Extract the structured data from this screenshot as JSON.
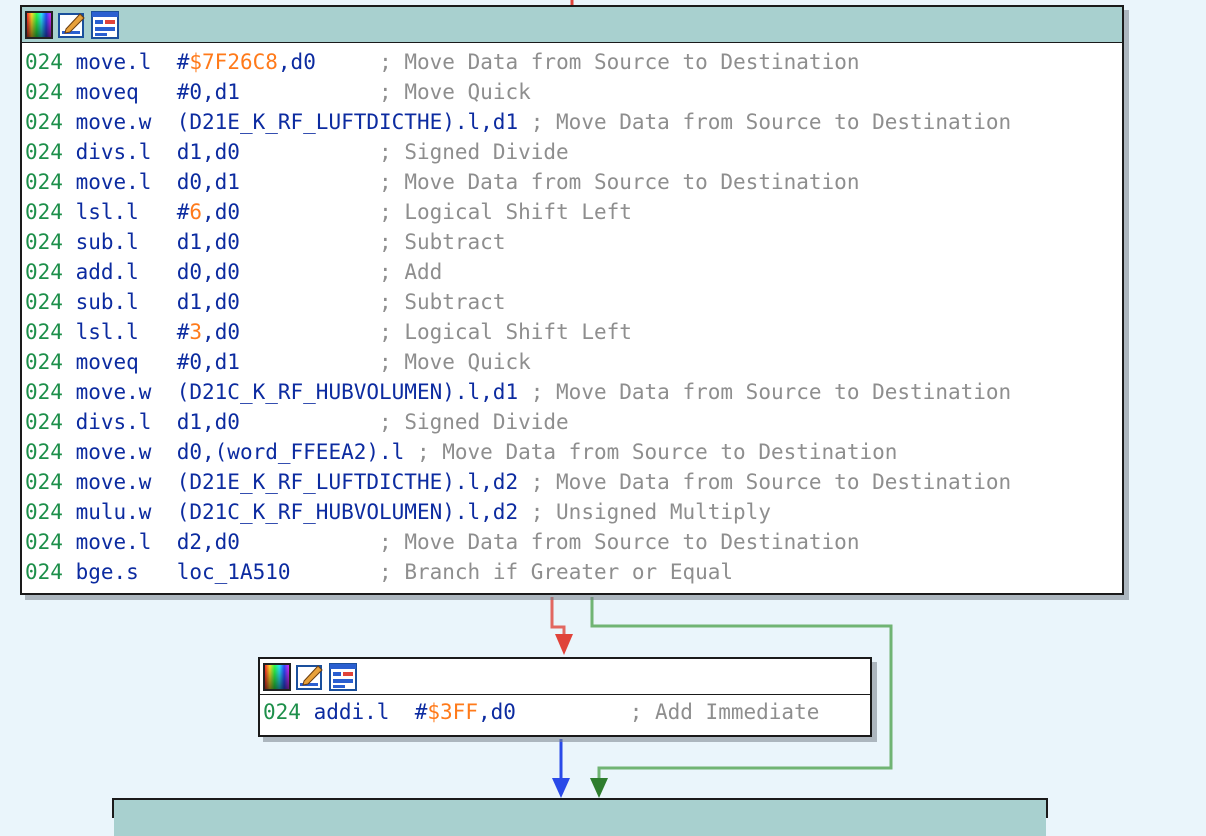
{
  "colors": {
    "background": "#eaf5fb",
    "header_active": "#a8d0cf",
    "segment": "#1d8f4a",
    "mnemonic": "#0c2ba0",
    "immediate": "#ff7a1a",
    "comment": "#8e8e8e",
    "edge_false": "#e0433a",
    "edge_true": "#5aa85a",
    "edge_normal": "#2a4ae8"
  },
  "main_block": {
    "header_icons": [
      "palette-icon",
      "rename-icon",
      "graph-icon"
    ],
    "lines": [
      [
        {
          "t": "seg",
          "v": "024"
        },
        {
          "t": "op",
          "v": " move.l  "
        },
        {
          "t": "op",
          "v": "#"
        },
        {
          "t": "imm",
          "v": "$7F26C8"
        },
        {
          "t": "op",
          "v": ",d0"
        },
        {
          "t": "pad",
          "v": "     "
        },
        {
          "t": "cmt",
          "v": "; Move Data from Source to Destination"
        }
      ],
      [
        {
          "t": "seg",
          "v": "024"
        },
        {
          "t": "op",
          "v": " moveq   "
        },
        {
          "t": "op",
          "v": "#0,d1"
        },
        {
          "t": "pad",
          "v": "           "
        },
        {
          "t": "cmt",
          "v": "; Move Quick"
        }
      ],
      [
        {
          "t": "seg",
          "v": "024"
        },
        {
          "t": "op",
          "v": " move.w  "
        },
        {
          "t": "op",
          "v": "(D21E_K_RF_LUFTDICTHE).l,d1 "
        },
        {
          "t": "cmt",
          "v": "; Move Data from Source to Destination"
        }
      ],
      [
        {
          "t": "seg",
          "v": "024"
        },
        {
          "t": "op",
          "v": " divs.l  "
        },
        {
          "t": "op",
          "v": "d1,d0"
        },
        {
          "t": "pad",
          "v": "           "
        },
        {
          "t": "cmt",
          "v": "; Signed Divide"
        }
      ],
      [
        {
          "t": "seg",
          "v": "024"
        },
        {
          "t": "op",
          "v": " move.l  "
        },
        {
          "t": "op",
          "v": "d0,d1"
        },
        {
          "t": "pad",
          "v": "           "
        },
        {
          "t": "cmt",
          "v": "; Move Data from Source to Destination"
        }
      ],
      [
        {
          "t": "seg",
          "v": "024"
        },
        {
          "t": "op",
          "v": " lsl.l   "
        },
        {
          "t": "op",
          "v": "#"
        },
        {
          "t": "imm",
          "v": "6"
        },
        {
          "t": "op",
          "v": ",d0"
        },
        {
          "t": "pad",
          "v": "           "
        },
        {
          "t": "cmt",
          "v": "; Logical Shift Left"
        }
      ],
      [
        {
          "t": "seg",
          "v": "024"
        },
        {
          "t": "op",
          "v": " sub.l   "
        },
        {
          "t": "op",
          "v": "d1,d0"
        },
        {
          "t": "pad",
          "v": "           "
        },
        {
          "t": "cmt",
          "v": "; Subtract"
        }
      ],
      [
        {
          "t": "seg",
          "v": "024"
        },
        {
          "t": "op",
          "v": " add.l   "
        },
        {
          "t": "op",
          "v": "d0,d0"
        },
        {
          "t": "pad",
          "v": "           "
        },
        {
          "t": "cmt",
          "v": "; Add"
        }
      ],
      [
        {
          "t": "seg",
          "v": "024"
        },
        {
          "t": "op",
          "v": " sub.l   "
        },
        {
          "t": "op",
          "v": "d1,d0"
        },
        {
          "t": "pad",
          "v": "           "
        },
        {
          "t": "cmt",
          "v": "; Subtract"
        }
      ],
      [
        {
          "t": "seg",
          "v": "024"
        },
        {
          "t": "op",
          "v": " lsl.l   "
        },
        {
          "t": "op",
          "v": "#"
        },
        {
          "t": "imm",
          "v": "3"
        },
        {
          "t": "op",
          "v": ",d0"
        },
        {
          "t": "pad",
          "v": "           "
        },
        {
          "t": "cmt",
          "v": "; Logical Shift Left"
        }
      ],
      [
        {
          "t": "seg",
          "v": "024"
        },
        {
          "t": "op",
          "v": " moveq   "
        },
        {
          "t": "op",
          "v": "#0,d1"
        },
        {
          "t": "pad",
          "v": "           "
        },
        {
          "t": "cmt",
          "v": "; Move Quick"
        }
      ],
      [
        {
          "t": "seg",
          "v": "024"
        },
        {
          "t": "op",
          "v": " move.w  "
        },
        {
          "t": "op",
          "v": "(D21C_K_RF_HUBVOLUMEN).l,d1 "
        },
        {
          "t": "cmt",
          "v": "; Move Data from Source to Destination"
        }
      ],
      [
        {
          "t": "seg",
          "v": "024"
        },
        {
          "t": "op",
          "v": " divs.l  "
        },
        {
          "t": "op",
          "v": "d1,d0"
        },
        {
          "t": "pad",
          "v": "           "
        },
        {
          "t": "cmt",
          "v": "; Signed Divide"
        }
      ],
      [
        {
          "t": "seg",
          "v": "024"
        },
        {
          "t": "op",
          "v": " move.w  "
        },
        {
          "t": "op",
          "v": "d0,(word_FFEEA2).l "
        },
        {
          "t": "cmt",
          "v": "; Move Data from Source to Destination"
        }
      ],
      [
        {
          "t": "seg",
          "v": "024"
        },
        {
          "t": "op",
          "v": " move.w  "
        },
        {
          "t": "op",
          "v": "(D21E_K_RF_LUFTDICTHE).l,d2 "
        },
        {
          "t": "cmt",
          "v": "; Move Data from Source to Destination"
        }
      ],
      [
        {
          "t": "seg",
          "v": "024"
        },
        {
          "t": "op",
          "v": " mulu.w  "
        },
        {
          "t": "op",
          "v": "(D21C_K_RF_HUBVOLUMEN).l,d2 "
        },
        {
          "t": "cmt",
          "v": "; Unsigned Multiply"
        }
      ],
      [
        {
          "t": "seg",
          "v": "024"
        },
        {
          "t": "op",
          "v": " move.l  "
        },
        {
          "t": "op",
          "v": "d2,d0"
        },
        {
          "t": "pad",
          "v": "           "
        },
        {
          "t": "cmt",
          "v": "; Move Data from Source to Destination"
        }
      ],
      [
        {
          "t": "seg",
          "v": "024"
        },
        {
          "t": "op",
          "v": " bge.s   "
        },
        {
          "t": "op",
          "v": "loc_1A510"
        },
        {
          "t": "pad",
          "v": "       "
        },
        {
          "t": "cmt",
          "v": "; Branch if Greater or Equal"
        }
      ]
    ]
  },
  "addi_block": {
    "header_icons": [
      "palette-icon",
      "rename-icon",
      "graph-icon"
    ],
    "lines": [
      [
        {
          "t": "seg",
          "v": "024"
        },
        {
          "t": "op",
          "v": " addi.l  "
        },
        {
          "t": "op",
          "v": "#"
        },
        {
          "t": "imm",
          "v": "$3FF"
        },
        {
          "t": "op",
          "v": ",d0"
        },
        {
          "t": "pad",
          "v": "         "
        },
        {
          "t": "cmt",
          "v": "; Add Immediate"
        }
      ]
    ]
  }
}
